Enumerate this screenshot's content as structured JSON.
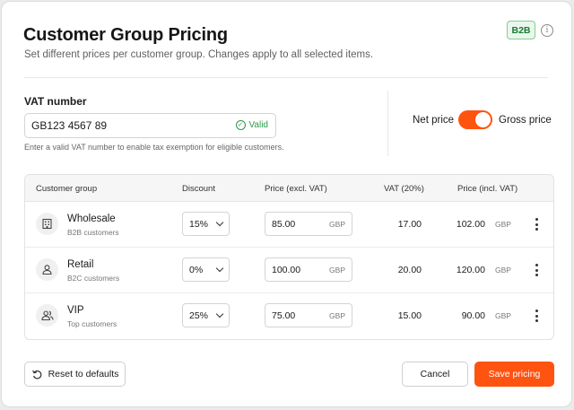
{
  "header": {
    "title": "Customer Group Pricing",
    "subtitle": "Set different prices per customer group. Changes apply to all selected items.",
    "badge": "B2B",
    "info_icon": "info-icon"
  },
  "vat": {
    "label": "VAT number",
    "value": "GB123 4567 89",
    "status": "Valid",
    "help": "Enter a valid VAT number to enable tax exemption for eligible customers."
  },
  "price_toggle": {
    "left_label": "Net price",
    "right_label": "Gross price",
    "selected": "Gross price",
    "on": true,
    "accent": "#ff5310"
  },
  "table": {
    "columns": [
      "Customer group",
      "Discount",
      "Price (excl. VAT)",
      "VAT (20%)",
      "Price (incl. VAT)"
    ],
    "rows": [
      {
        "icon": "building-icon",
        "name": "Wholesale",
        "sub": "B2B customers",
        "discount": "15%",
        "price_excl": "85.00",
        "currency": "GBP",
        "vat": "17.00",
        "price_incl": "102.00"
      },
      {
        "icon": "user-icon",
        "name": "Retail",
        "sub": "B2C customers",
        "discount": "0%",
        "price_excl": "100.00",
        "currency": "GBP",
        "vat": "20.00",
        "price_incl": "120.00"
      },
      {
        "icon": "users-icon",
        "name": "VIP",
        "sub": "Top customers",
        "discount": "25%",
        "price_excl": "75.00",
        "currency": "GBP",
        "vat": "15.00",
        "price_incl": "90.00"
      }
    ]
  },
  "footer": {
    "reset_label": "Reset to defaults",
    "cancel_label": "Cancel",
    "save_label": "Save pricing"
  },
  "colors": {
    "accent": "#ff5310",
    "valid": "#2c9a47",
    "badge_bg": "#eaf7ec"
  }
}
